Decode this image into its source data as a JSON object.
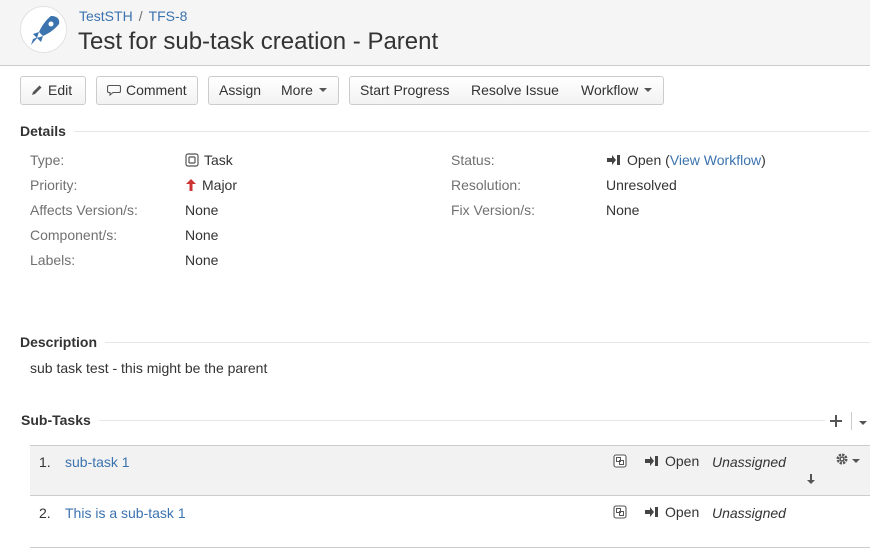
{
  "header": {
    "breadcrumb": {
      "project": "TestSTH",
      "separator": "/",
      "issue_key": "TFS-8"
    },
    "title": "Test for sub-task creation - Parent",
    "avatar_icon": "rocket-icon"
  },
  "toolbar": {
    "edit": "Edit",
    "comment": "Comment",
    "assign": "Assign",
    "more": "More",
    "start_progress": "Start Progress",
    "resolve_issue": "Resolve Issue",
    "workflow": "Workflow"
  },
  "details": {
    "heading": "Details",
    "type_label": "Type:",
    "type_value": "Task",
    "priority_label": "Priority:",
    "priority_value": "Major",
    "affects_label": "Affects Version/s:",
    "affects_value": "None",
    "components_label": "Component/s:",
    "components_value": "None",
    "labels_label": "Labels:",
    "labels_value": "None",
    "status_label": "Status:",
    "status_value": "Open",
    "status_open_paren": "(",
    "view_workflow": "View Workflow",
    "status_close_paren": ")",
    "resolution_label": "Resolution:",
    "resolution_value": "Unresolved",
    "fix_label": "Fix Version/s:",
    "fix_value": "None"
  },
  "description": {
    "heading": "Description",
    "text": "sub task test - this might be the parent"
  },
  "subtasks": {
    "heading": "Sub-Tasks",
    "items": [
      {
        "num": "1.",
        "title": "sub-task 1",
        "status": "Open",
        "assignee": "Unassigned"
      },
      {
        "num": "2.",
        "title": "This is a sub-task 1",
        "status": "Open",
        "assignee": "Unassigned"
      }
    ]
  },
  "colors": {
    "link": "#3b73af",
    "priority_major": "#cc3333",
    "rocket": "#3b73af"
  }
}
